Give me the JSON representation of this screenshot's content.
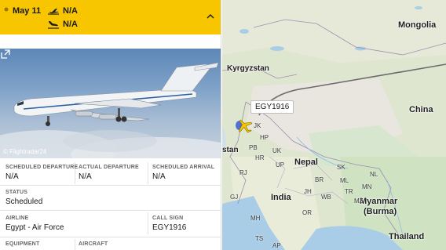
{
  "header": {
    "date": "May 11",
    "departure_time": "N/A",
    "arrival_time": "N/A"
  },
  "photo": {
    "credit": "© Flightradar24"
  },
  "details": {
    "scheduled_departure_label": "SCHEDULED DEPARTURE",
    "scheduled_departure_value": "N/A",
    "actual_departure_label": "ACTUAL DEPARTURE",
    "actual_departure_value": "N/A",
    "scheduled_arrival_label": "SCHEDULED ARRIVAL",
    "scheduled_arrival_value": "N/A",
    "status_label": "STATUS",
    "status_value": "Scheduled",
    "airline_label": "AIRLINE",
    "airline_value": "Egypt - Air Force",
    "callsign_label": "CALL SIGN",
    "callsign_value": "EGY1916",
    "equipment_label": "EQUIPMENT",
    "aircraft_label": "AIRCRAFT"
  },
  "map": {
    "flight_label": "EGY1916",
    "countries": [
      "Mongolia",
      "Kyrgyzstan",
      "China",
      "stan",
      "Nepal",
      "India",
      "Myanmar",
      "(Burma)",
      "Thailand"
    ],
    "states": [
      "JK",
      "PB",
      "HR",
      "HP",
      "UK",
      "RJ",
      "UP",
      "GJ",
      "MH",
      "BR",
      "SK",
      "ML",
      "NL",
      "MN",
      "TR",
      "JH",
      "WB",
      "MZ",
      "OR",
      "TS",
      "AP"
    ]
  },
  "colors": {
    "header_yellow": "#f7c600",
    "plane_marker": "#f7c600",
    "map_land": "#dfe6d0",
    "map_water": "#a9cde6"
  }
}
